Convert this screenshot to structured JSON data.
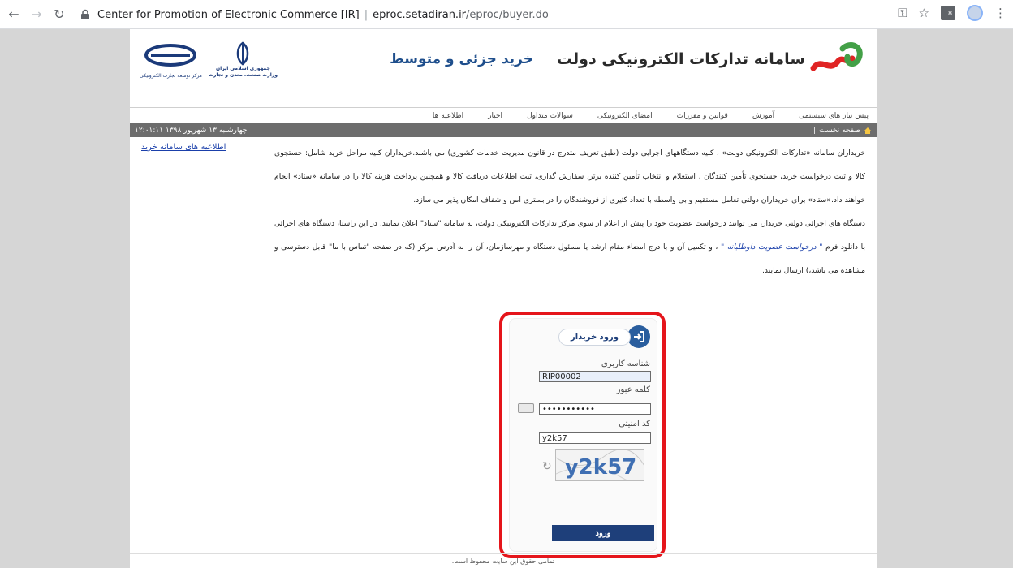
{
  "browser": {
    "url_site": "Center for Promotion of Electronic Commerce [IR]",
    "url_host": "eproc.setadiran.ir",
    "url_path": "/eproc/buyer.do",
    "ext_badge": "18"
  },
  "header": {
    "brand_title": "سامانه تدارکات الکترونیکی دولت",
    "brand_sub": "خرید جزئی و متوسط",
    "gov_line1": "جمهوری اسلامی ایران",
    "gov_line2": "وزارت صنعت، معدن و تجارت",
    "tpo_text": "مرکز توسعه تجارت الکترونیکی"
  },
  "menu": {
    "items": [
      "پیش نیاز های سیستمی",
      "آموزش",
      "قوانین و مقررات",
      "امضای الکترونیکی",
      "سوالات متداول",
      "اخبار",
      "اطلاعیه ها"
    ]
  },
  "status": {
    "home": "صفحه نخست",
    "date": "چهارشنبه ۱۳ شهریور ۱۳۹۸  ۱۲:۰۱:۱۱"
  },
  "sidebar": {
    "announcements_link": "اطلاعیه های سامانه خرید"
  },
  "main": {
    "para1": "خریداران سامانه «تدارکات الکترونیکی دولت» ، کلیه دستگاههای اجرایی دولت (طبق تعریف متدرج در قانون مدیریت خدمات کشوری) می باشند.خریداران کلیه مراحل خرید شامل: جستجوی کالا و ثبت درخواست خرید، جستجوی تأمین کنندگان ، استعلام و انتخاب تأمین کننده برتر، سفارش گذاری، ثبت اطلاعات دریافت کالا و همچنین پرداخت هزینه کالا را در سامانه «ستاد» انجام خواهند داد.«ستاد» برای خریداران دولتی تعامل مستقیم و بی واسطه با تعداد کثیری از فروشندگان را در بستری امن و شفاف امکان پذیر می سازد.",
    "para2_a": "دستگاه های اجرائی دولتی خریدار، می توانند درخواست عضویت خود را پیش از اعلام از سوی مرکز تدارکات الکترونیکی دولت، به سامانه \"ستاد\" اعلان نمایند. در این راستا، دستگاه های اجرائی با دانلود فرم",
    "para2_link": "\" درخواست عضویت داوطلبانه \"",
    "para2_b": "، و تکمیل آن و با درج امضاء مقام ارشد یا مسئول دستگاه و مهرسازمان، آن را به آدرس مرکز (که در صفحه \"تماس با ما\" قابل دسترسی و مشاهده می باشد،) ارسال نمایند."
  },
  "login": {
    "title": "ورود خریدار",
    "username_label": "شناسه کاربری",
    "username_value": "RIP00002",
    "password_label": "کلمه عبور",
    "password_value": "•••••••••••",
    "captcha_label": "کد امنیتی",
    "captcha_value": "y2k57",
    "captcha_image_text": "y2k57",
    "submit_label": "ورود"
  },
  "footer": {
    "copyright": "تمامی حقوق این سایت محفوظ است."
  }
}
